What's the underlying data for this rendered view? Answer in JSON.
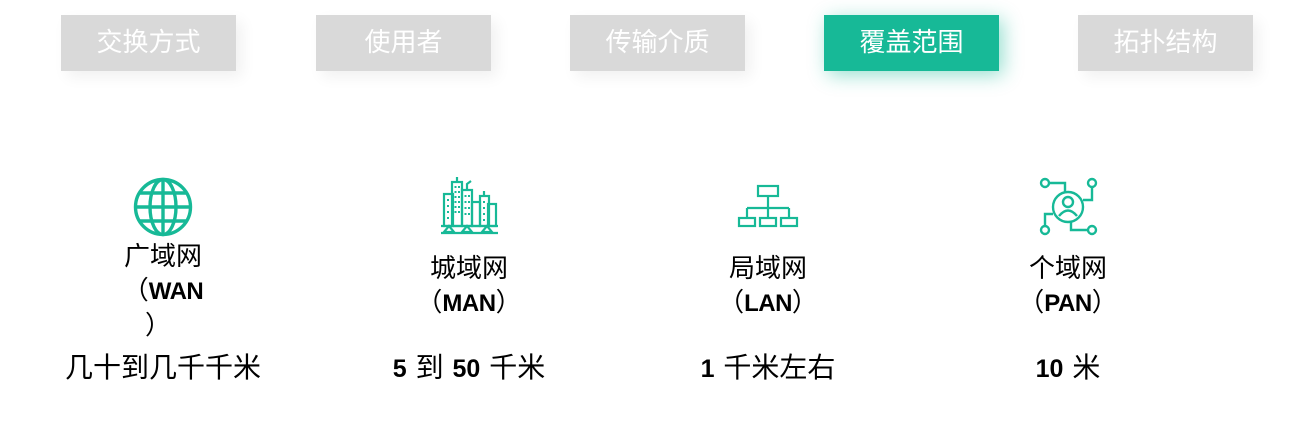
{
  "tabs": [
    {
      "label": "交换方式",
      "active": false
    },
    {
      "label": "使用者",
      "active": false
    },
    {
      "label": "传输介质",
      "active": false
    },
    {
      "label": "覆盖范围",
      "active": true
    },
    {
      "label": "拓扑结构",
      "active": false
    }
  ],
  "accent_color": "#17b997",
  "inactive_tab_color": "#d9d9d9",
  "networks": [
    {
      "icon": "globe-icon",
      "name": "广域网",
      "open": "（",
      "abbr": "WAN",
      "close": "）",
      "range_num": "",
      "range_text": "几十到几千千米"
    },
    {
      "icon": "city-buildings-icon",
      "name": "城域网",
      "open": "（",
      "abbr": "MAN",
      "close": "）",
      "range_num": "5",
      "range_text": "到",
      "range_num2": "50",
      "range_text2": "千米"
    },
    {
      "icon": "network-hierarchy-icon",
      "name": "局域网",
      "open": "（",
      "abbr": "LAN",
      "close": "）",
      "range_num": "1",
      "range_text": "千米左右"
    },
    {
      "icon": "personal-network-icon",
      "name": "个域网",
      "open": "（",
      "abbr": "PAN",
      "close": "）",
      "range_num": "10",
      "range_text": "米"
    }
  ]
}
